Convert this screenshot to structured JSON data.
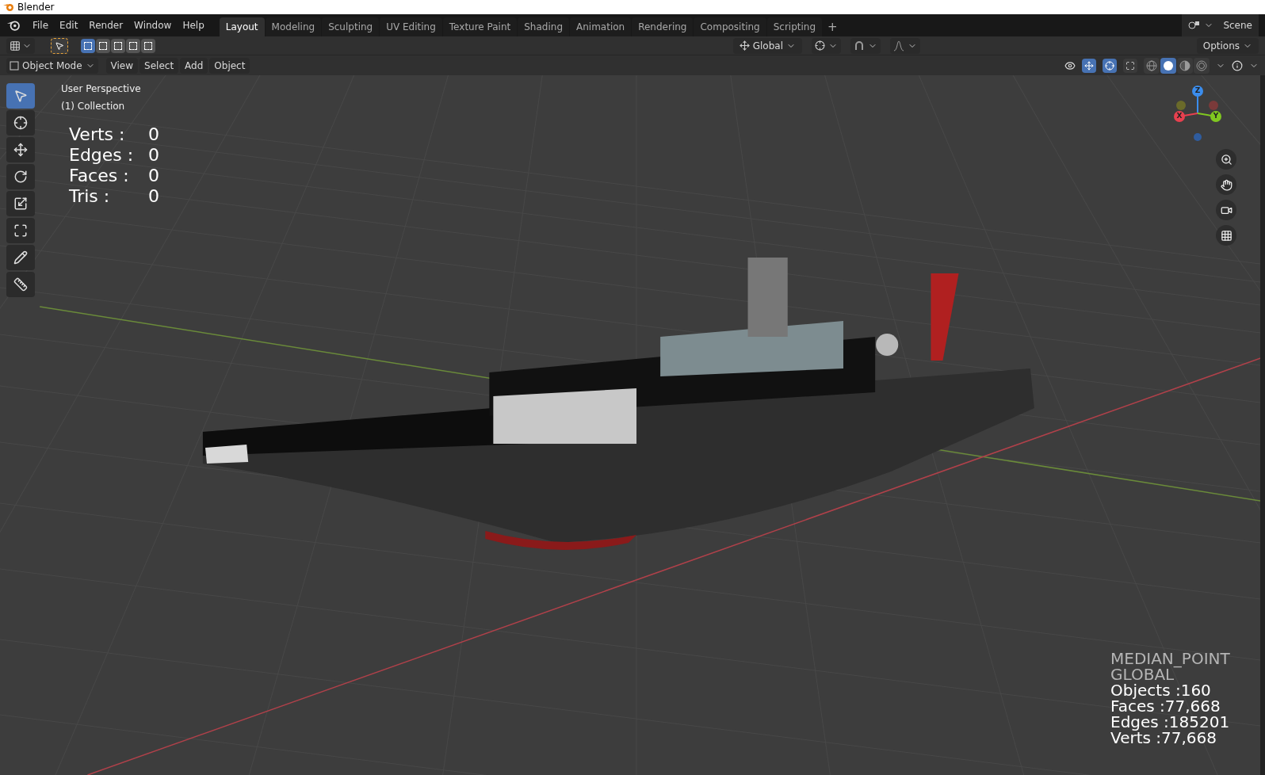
{
  "window": {
    "title": "Blender"
  },
  "menu": [
    "File",
    "Edit",
    "Render",
    "Window",
    "Help"
  ],
  "workspaces": [
    {
      "label": "Layout",
      "selected": true
    },
    {
      "label": "Modeling",
      "selected": false
    },
    {
      "label": "Sculpting",
      "selected": false
    },
    {
      "label": "UV Editing",
      "selected": false
    },
    {
      "label": "Texture Paint",
      "selected": false
    },
    {
      "label": "Shading",
      "selected": false
    },
    {
      "label": "Animation",
      "selected": false
    },
    {
      "label": "Rendering",
      "selected": false
    },
    {
      "label": "Compositing",
      "selected": false
    },
    {
      "label": "Scripting",
      "selected": false
    }
  ],
  "add_workspace": "+",
  "scene": "Scene",
  "select_modes": [
    {
      "selected": true
    },
    {
      "selected": false
    },
    {
      "selected": false
    },
    {
      "selected": false
    },
    {
      "selected": false
    }
  ],
  "tool_header": {
    "orientation": "Global",
    "options": "Options"
  },
  "viewport_header": {
    "mode": "Object Mode",
    "menus": [
      "View",
      "Select",
      "Add",
      "Object"
    ]
  },
  "shading_modes": [
    {
      "kind": "wireframe",
      "selected": false
    },
    {
      "kind": "solid",
      "selected": true
    },
    {
      "kind": "material",
      "selected": false
    },
    {
      "kind": "rendered",
      "selected": false
    }
  ],
  "tools": [
    {
      "kind": "select",
      "selected": true
    },
    {
      "kind": "cursor",
      "selected": false
    },
    {
      "kind": "move",
      "selected": false
    },
    {
      "kind": "rotate",
      "selected": false
    },
    {
      "kind": "scale",
      "selected": false
    },
    {
      "kind": "transform",
      "selected": false
    },
    {
      "kind": "annotate",
      "selected": false
    },
    {
      "kind": "measure",
      "selected": false
    }
  ],
  "viewport": {
    "view_name": "User Perspective",
    "collection": "(1) Collection",
    "stats": [
      {
        "label": "Verts :",
        "value": "0"
      },
      {
        "label": "Edges :",
        "value": "0"
      },
      {
        "label": "Faces :",
        "value": "0"
      },
      {
        "label": "Tris :",
        "value": "0"
      }
    ],
    "overlay_lines": [
      {
        "text": "MEDIAN_POINT",
        "kind": "setting"
      },
      {
        "text": "GLOBAL",
        "kind": "setting"
      },
      {
        "text": "Objects :160",
        "kind": "count"
      },
      {
        "text": "Faces :77,668",
        "kind": "count"
      },
      {
        "text": "Edges :185201",
        "kind": "count"
      },
      {
        "text": "Verts :77,668",
        "kind": "count"
      }
    ]
  },
  "gizmo": {
    "axes": [
      {
        "label": "X",
        "color": "#e8404f"
      },
      {
        "label": "Y",
        "color": "#80c820"
      },
      {
        "label": "Z",
        "color": "#3b8ded"
      }
    ]
  }
}
